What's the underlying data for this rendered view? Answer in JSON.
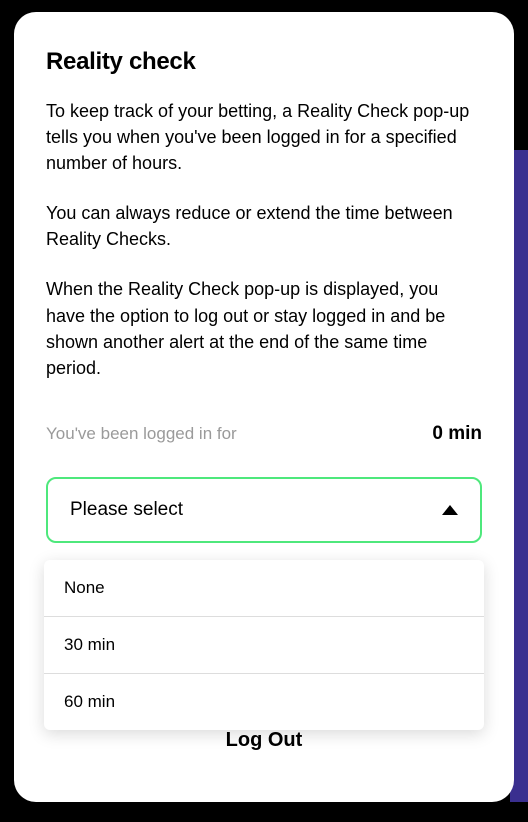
{
  "modal": {
    "title": "Reality check",
    "paragraphs": [
      "To keep track of your betting, a Reality Check pop-up tells you when you've been logged in for a specified number of hours.",
      "You can always reduce or extend the time between Reality Checks.",
      "When the Reality Check pop-up is displayed, you have the option to log out or stay logged in and be shown another alert at the end of the same time period."
    ],
    "logged_in_label": "You've been logged in for",
    "logged_in_value": "0 min",
    "select_placeholder": "Please select",
    "dropdown_options": [
      "None",
      "30 min",
      "60 min"
    ],
    "logout_label": "Log Out"
  },
  "colors": {
    "accent_green": "#4ee87c",
    "muted_text": "#9a9a9a"
  }
}
